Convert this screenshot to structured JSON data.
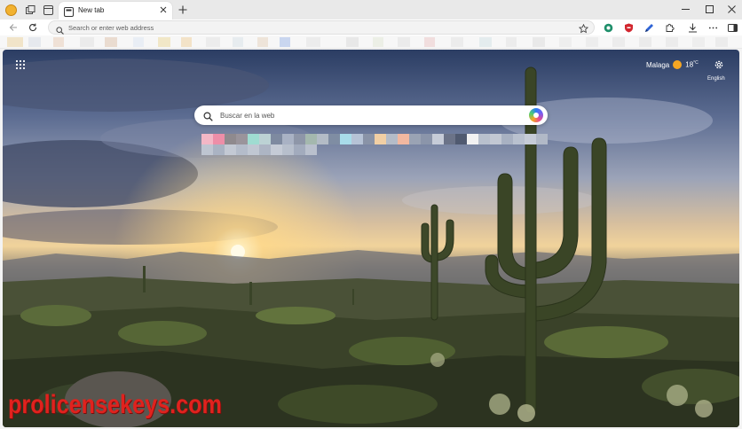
{
  "tabstrip": {
    "active_tab_title": "New tab"
  },
  "toolbar": {
    "address_placeholder": "Search or enter web address"
  },
  "ntp": {
    "weather_city": "Malaga",
    "weather_temp": "18",
    "weather_unit": "°C",
    "language": "English",
    "search_placeholder": "Buscar en la web"
  },
  "watermark": {
    "text": "prolicensekeys.com"
  },
  "icons": [
    "profile-icon",
    "workspaces-icon",
    "tab-actions-icon",
    "new-tab-favicon",
    "close-icon",
    "plus-icon",
    "minimize-icon",
    "maximize-icon",
    "window-close-icon",
    "back-arrow-icon",
    "refresh-icon",
    "search-icon",
    "star-icon",
    "extension-icon",
    "shield-icon",
    "pen-icon",
    "puzzle-icon",
    "download-icon",
    "more-icon",
    "sidebar-icon",
    "apps-grid-icon",
    "sun-icon",
    "gear-icon",
    "copilot-icon"
  ],
  "colors": {
    "tabstrip": "#e9e9e9",
    "toolbar": "#ffffff",
    "watermark": "#e0221e",
    "weather_sun": "#f5a623"
  }
}
